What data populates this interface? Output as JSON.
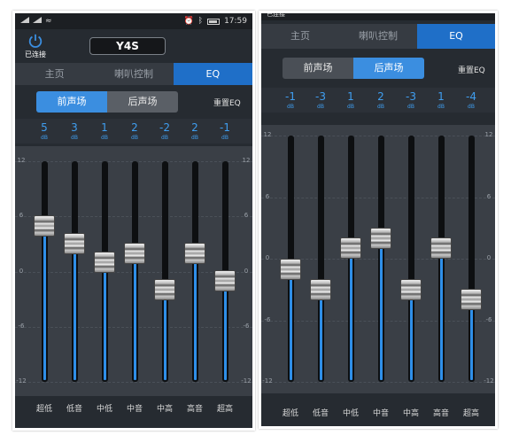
{
  "left": {
    "status": {
      "carrier_icons": "signal-wifi-icons",
      "time": "17:59"
    },
    "connection_label": "已连接",
    "device_name": "Y4S",
    "tabs": [
      {
        "label": "主页",
        "active": false
      },
      {
        "label": "喇叭控制",
        "active": false
      },
      {
        "label": "EQ",
        "active": true
      }
    ],
    "soundfield": {
      "front": "前声场",
      "rear": "后声场",
      "active": "front"
    },
    "reset_label": "重置EQ",
    "unit": "dB",
    "scale": {
      "top": "12",
      "upper": "6",
      "zero": "0",
      "lower": "-6",
      "bottom": "-12"
    },
    "bands": [
      {
        "label": "超低",
        "value": 5
      },
      {
        "label": "低音",
        "value": 3
      },
      {
        "label": "中低",
        "value": 1
      },
      {
        "label": "中音",
        "value": 2
      },
      {
        "label": "中高",
        "value": -2
      },
      {
        "label": "高音",
        "value": 2
      },
      {
        "label": "超高",
        "value": -1
      }
    ]
  },
  "right": {
    "connection_label": "已连接",
    "tabs": [
      {
        "label": "主页",
        "active": false
      },
      {
        "label": "喇叭控制",
        "active": false
      },
      {
        "label": "EQ",
        "active": true
      }
    ],
    "soundfield": {
      "front": "前声场",
      "rear": "后声场",
      "active": "rear"
    },
    "reset_label": "重置EQ",
    "unit": "dB",
    "scale": {
      "top": "12",
      "upper": "6",
      "zero": "0",
      "lower": "-6",
      "bottom": "-12"
    },
    "bands": [
      {
        "label": "超低",
        "value": -1
      },
      {
        "label": "低音",
        "value": -3
      },
      {
        "label": "中低",
        "value": 1
      },
      {
        "label": "中音",
        "value": 2
      },
      {
        "label": "中高",
        "value": -3
      },
      {
        "label": "高音",
        "value": 1
      },
      {
        "label": "超高",
        "value": -4
      }
    ]
  },
  "colors": {
    "accent": "#1f6fc8",
    "value_text": "#3f9ef0",
    "panel": "#262b31"
  }
}
